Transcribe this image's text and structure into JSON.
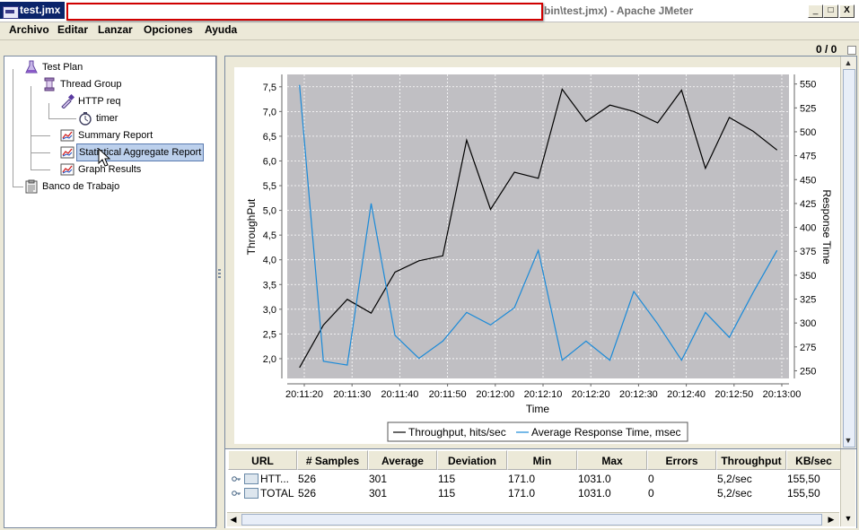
{
  "window": {
    "tab_title": "test.jmx",
    "title_tail": "bin\\test.jmx) - Apache JMeter",
    "btn_minimize": "_",
    "btn_maximize": "□",
    "btn_close": "X"
  },
  "menu": [
    "Archivo",
    "Editar",
    "Lanzar",
    "Opciones",
    "Ayuda"
  ],
  "toolbar": {
    "counter": "0 / 0"
  },
  "tree": [
    {
      "label": "Test Plan",
      "icon": "flask-icon"
    },
    {
      "label": "Thread Group",
      "icon": "spool-icon"
    },
    {
      "label": "HTTP req",
      "icon": "pipette-icon"
    },
    {
      "label": "timer",
      "icon": "stopwatch-icon"
    },
    {
      "label": "Summary Report",
      "icon": "report-icon"
    },
    {
      "label": "Statistical Aggregate Report",
      "icon": "report-icon",
      "selected": true
    },
    {
      "label": "Graph Results",
      "icon": "report-icon"
    },
    {
      "label": "Banco de Trabajo",
      "icon": "clipboard-icon"
    }
  ],
  "chart_data": {
    "type": "line",
    "xlabel": "Time",
    "ylabel_left": "ThroughPut",
    "ylabel_right": "Response Time",
    "x_ticks": [
      "20:11:20",
      "20:11:30",
      "20:11:40",
      "20:11:50",
      "20:12:00",
      "20:12:10",
      "20:12:20",
      "20:12:30",
      "20:12:40",
      "20:12:50",
      "20:13:00"
    ],
    "y_left_ticks": [
      "2,0",
      "2,5",
      "3,0",
      "3,5",
      "4,0",
      "4,5",
      "5,0",
      "5,5",
      "6,0",
      "6,5",
      "7,0",
      "7,5"
    ],
    "y_right_ticks": [
      "250",
      "275",
      "300",
      "325",
      "350",
      "375",
      "400",
      "425",
      "450",
      "475",
      "500",
      "525",
      "550"
    ],
    "ylim_left": [
      1.6,
      7.75
    ],
    "ylim_right": [
      242,
      560
    ],
    "x_seconds": [
      -2,
      2,
      6,
      10,
      14,
      18,
      22,
      26,
      30,
      34,
      38,
      42,
      46,
      50,
      54,
      58,
      62,
      66,
      70,
      74,
      78,
      82,
      86,
      90,
      94,
      98
    ],
    "x_start_label": "20:11:20",
    "series": [
      {
        "name": "Throughput, hits/sec",
        "color": "#000000",
        "axis": "left",
        "values": [
          1.82,
          2.68,
          3.2,
          2.92,
          3.75,
          3.98,
          4.08,
          6.42,
          5.02,
          5.77,
          5.65,
          7.45,
          6.8,
          7.13,
          7.0,
          6.77,
          7.43,
          5.85,
          6.88,
          6.6,
          6.22
        ]
      },
      {
        "name": "Average Response Time, msec",
        "color": "#1a8ad8",
        "axis": "right",
        "values": [
          549,
          260,
          256,
          425,
          287,
          263,
          281,
          311,
          298,
          316,
          376,
          261,
          281,
          261,
          333,
          299,
          261,
          311,
          285,
          332,
          376
        ]
      }
    ],
    "grid": true,
    "legend_placement": "bottom"
  },
  "table": {
    "headers": [
      "URL",
      "# Samples",
      "Average",
      "Deviation",
      "Min",
      "Max",
      "Errors",
      "Throughput",
      "KB/sec"
    ],
    "rows": [
      [
        "HTT...",
        "526",
        "301",
        "115",
        "171.0",
        "1031.0",
        "0",
        "5,2/sec",
        "155,50"
      ],
      [
        "TOTAL",
        "526",
        "301",
        "115",
        "171.0",
        "1031.0",
        "0",
        "5,2/sec",
        "155,50"
      ]
    ]
  }
}
